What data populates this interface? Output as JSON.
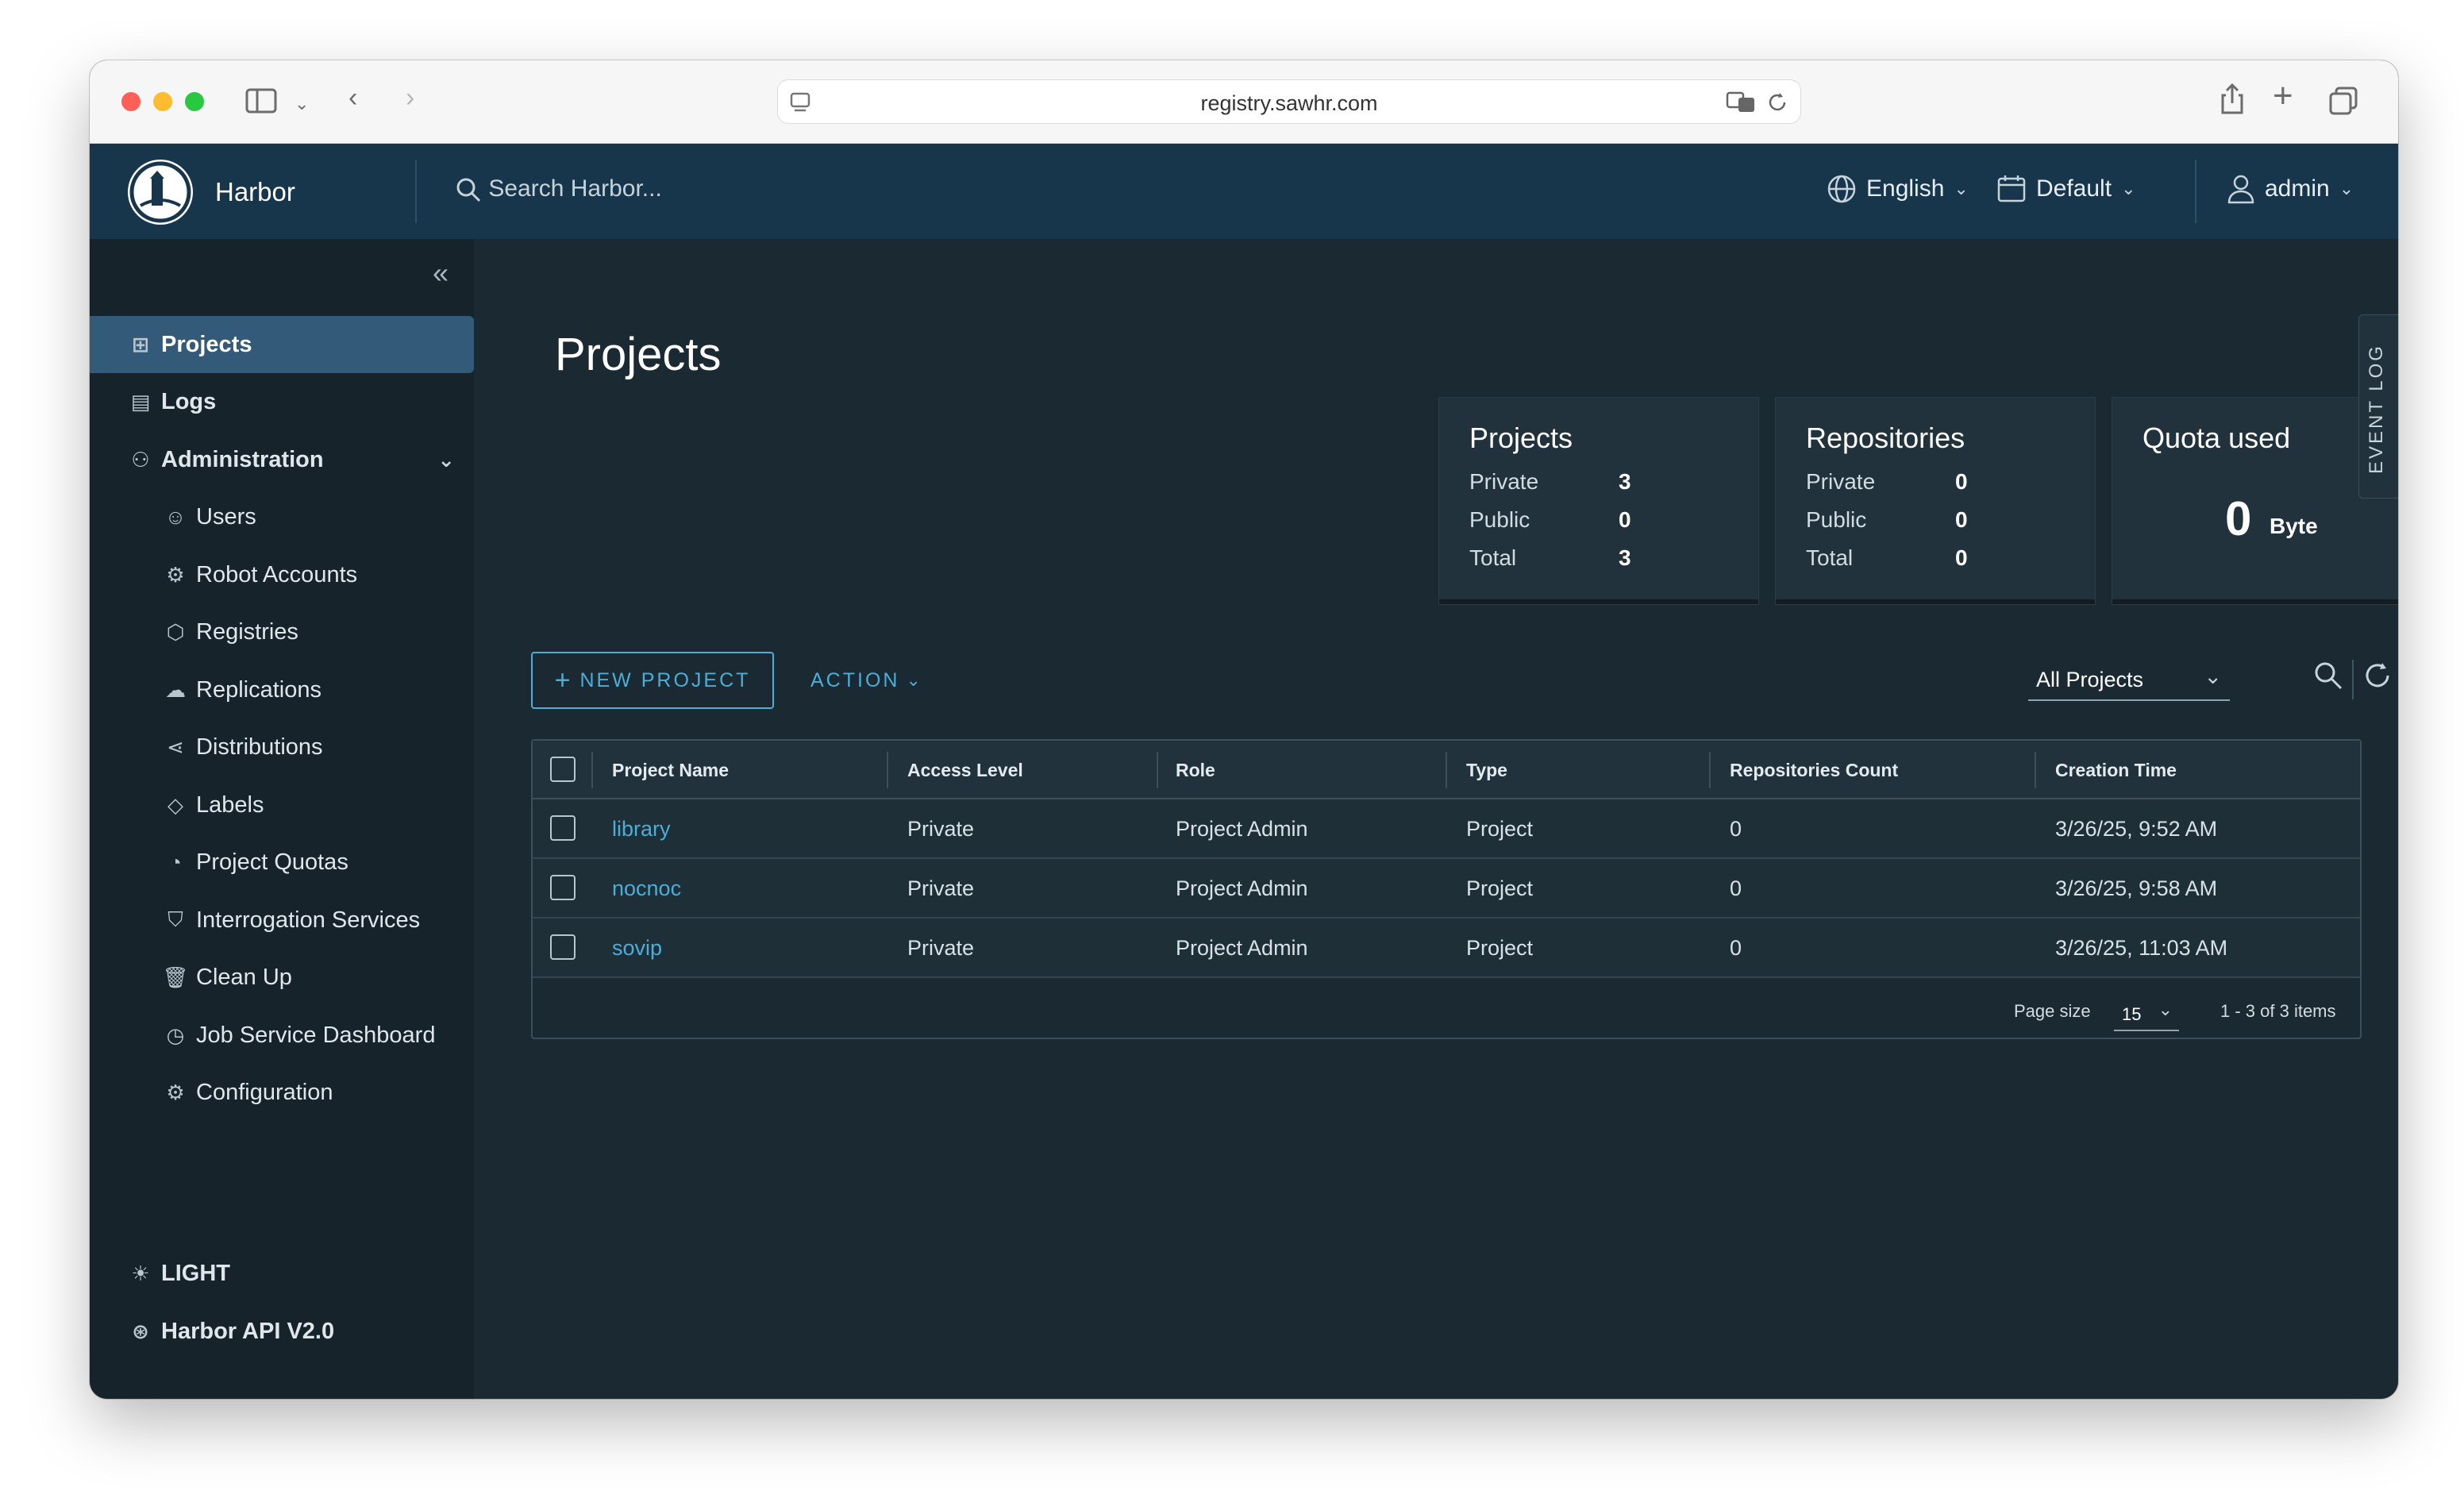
{
  "browser": {
    "url": "registry.sawhr.com"
  },
  "header": {
    "brand": "Harbor",
    "search_placeholder": "Search Harbor...",
    "language": "English",
    "datetime_format": "Default",
    "user": "admin"
  },
  "sidebar": {
    "items": [
      {
        "label": "Projects",
        "icon": "projects-icon"
      },
      {
        "label": "Logs",
        "icon": "logs-icon"
      },
      {
        "label": "Administration",
        "icon": "administration-icon"
      },
      {
        "label": "Users",
        "icon": "users-icon"
      },
      {
        "label": "Robot Accounts",
        "icon": "robot-icon"
      },
      {
        "label": "Registries",
        "icon": "registries-icon"
      },
      {
        "label": "Replications",
        "icon": "replications-icon"
      },
      {
        "label": "Distributions",
        "icon": "distributions-icon"
      },
      {
        "label": "Labels",
        "icon": "labels-icon"
      },
      {
        "label": "Project Quotas",
        "icon": "quotas-icon"
      },
      {
        "label": "Interrogation Services",
        "icon": "shield-icon"
      },
      {
        "label": "Clean Up",
        "icon": "trash-icon"
      },
      {
        "label": "Job Service Dashboard",
        "icon": "dashboard-icon"
      },
      {
        "label": "Configuration",
        "icon": "gear-icon"
      }
    ],
    "theme_toggle": "LIGHT",
    "api_link": "Harbor API V2.0"
  },
  "main": {
    "title": "Projects",
    "cards": {
      "projects": {
        "title": "Projects",
        "private_label": "Private",
        "private": "3",
        "public_label": "Public",
        "public": "0",
        "total_label": "Total",
        "total": "3"
      },
      "repositories": {
        "title": "Repositories",
        "private_label": "Private",
        "private": "0",
        "public_label": "Public",
        "public": "0",
        "total_label": "Total",
        "total": "0"
      },
      "quota": {
        "title": "Quota used",
        "value": "0",
        "unit": "Byte"
      }
    },
    "event_log": "EVENT LOG",
    "new_project": "NEW PROJECT",
    "action": "ACTION",
    "filter": "All Projects",
    "table": {
      "headers": [
        "Project Name",
        "Access Level",
        "Role",
        "Type",
        "Repositories Count",
        "Creation Time"
      ],
      "rows": [
        [
          "library",
          "Private",
          "Project Admin",
          "Project",
          "0",
          "3/26/25, 9:52 AM"
        ],
        [
          "nocnoc",
          "Private",
          "Project Admin",
          "Project",
          "0",
          "3/26/25, 9:58 AM"
        ],
        [
          "sovip",
          "Private",
          "Project Admin",
          "Project",
          "0",
          "3/26/25, 11:03 AM"
        ]
      ],
      "page_size_label": "Page size",
      "page_size": "15",
      "item_count": "1 - 3 of 3 items"
    }
  }
}
